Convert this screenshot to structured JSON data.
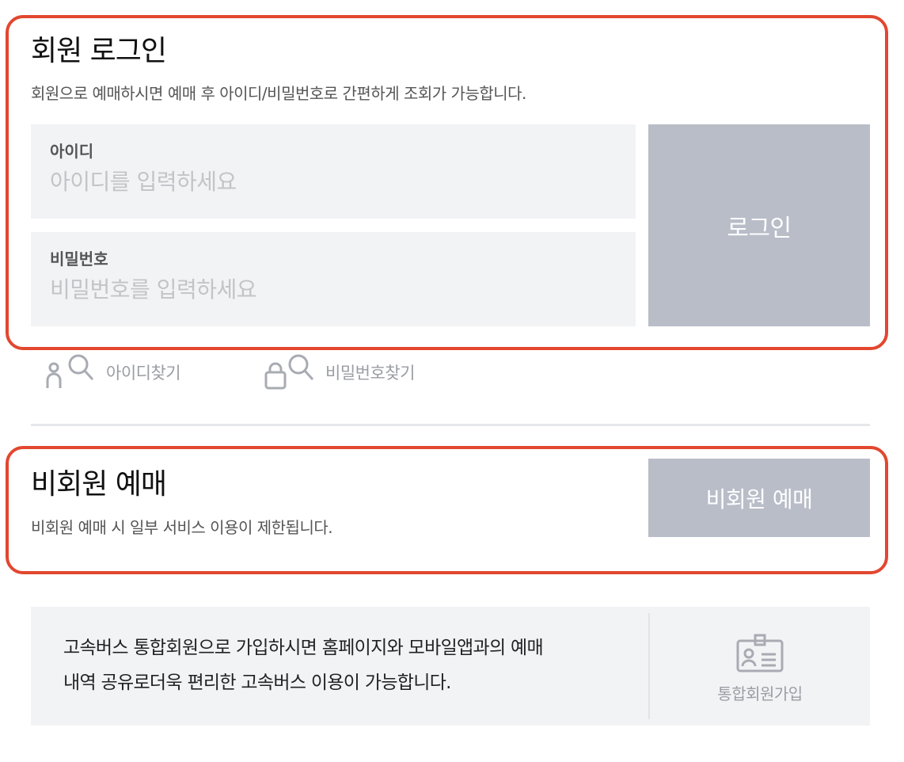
{
  "login": {
    "title": "회원 로그인",
    "description": "회원으로 예매하시면 예매 후 아이디/비밀번호로 간편하게 조회가 가능합니다.",
    "id_label": "아이디",
    "id_placeholder": "아이디를 입력하세요",
    "id_value": "",
    "pw_label": "비밀번호",
    "pw_placeholder": "비밀번호를 입력하세요",
    "pw_value": "",
    "login_button": "로그인",
    "find_id": "아이디찾기",
    "find_pw": "비밀번호찾기"
  },
  "guest": {
    "title": "비회원 예매",
    "description": "비회원 예매 시 일부 서비스 이용이 제한됩니다.",
    "button": "비회원 예매"
  },
  "join": {
    "text_line1": "고속버스 통합회원으로 가입하시면 홈페이지와 모바일앱과의 예매",
    "text_line2": "내역 공유로더욱 편리한 고속버스 이용이 가능합니다.",
    "button_label": "통합회원가입"
  },
  "icons": {
    "find_id": "person-search-icon",
    "find_pw": "lock-search-icon",
    "join": "id-card-icon"
  },
  "colors": {
    "highlight": "#e2472f",
    "button_gray": "#b9bdc8",
    "panel_bg": "#f2f3f5",
    "muted_text": "#9a9da3"
  }
}
